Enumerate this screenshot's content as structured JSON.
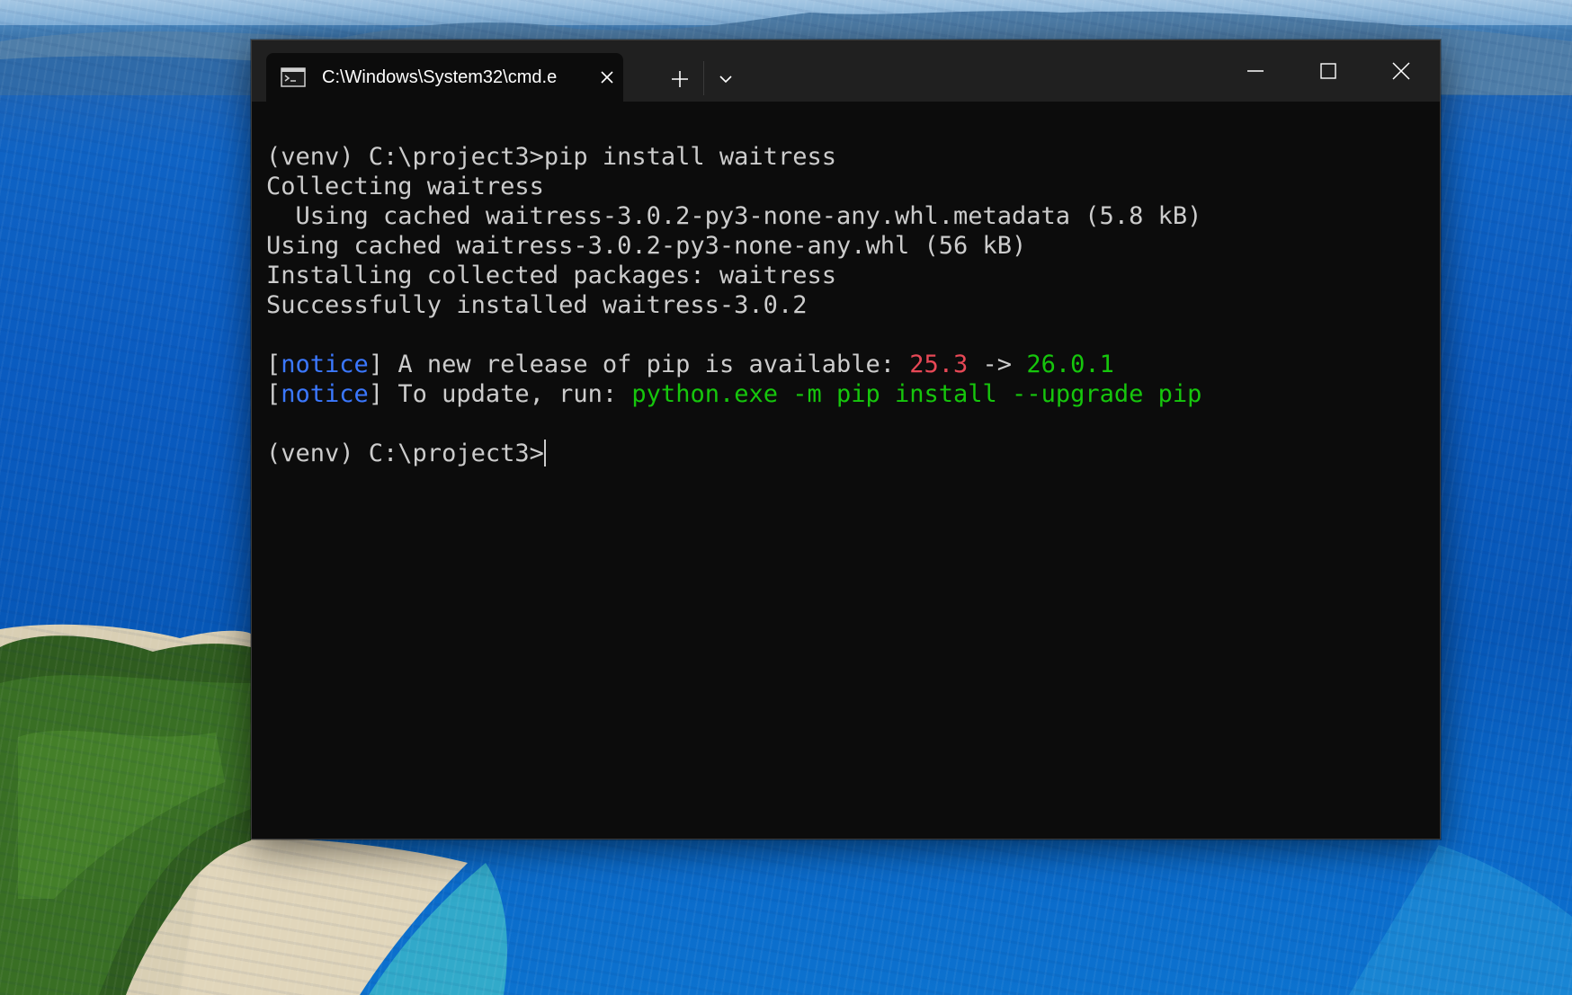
{
  "window": {
    "tab_title": "C:\\Windows\\System32\\cmd.e",
    "tab_icon": "cmd-icon",
    "controls": {
      "minimize_icon": "minimize-icon",
      "maximize_icon": "maximize-icon",
      "close_icon": "close-icon",
      "new_tab_icon": "plus-icon",
      "dropdown_icon": "chevron-down-icon"
    }
  },
  "colors": {
    "terminal_bg": "#0c0c0c",
    "titlebar_bg": "#202020",
    "text": "#cccccc",
    "notice_blue": "#3b78ff",
    "version_red": "#e74856",
    "version_green": "#16c60c"
  },
  "terminal": {
    "lines": [
      [
        {
          "text": "(venv) C:\\project3>pip install waitress",
          "color": "white"
        }
      ],
      [
        {
          "text": "Collecting waitress",
          "color": "white"
        }
      ],
      [
        {
          "text": "  Using cached waitress-3.0.2-py3-none-any.whl.metadata (5.8 kB)",
          "color": "white"
        }
      ],
      [
        {
          "text": "Using cached waitress-3.0.2-py3-none-any.whl (56 kB)",
          "color": "white"
        }
      ],
      [
        {
          "text": "Installing collected packages: waitress",
          "color": "white"
        }
      ],
      [
        {
          "text": "Successfully installed waitress-3.0.2",
          "color": "white"
        }
      ],
      [],
      [
        {
          "text": "[",
          "color": "white"
        },
        {
          "text": "notice",
          "color": "blue"
        },
        {
          "text": "] A new release of pip is available: ",
          "color": "white"
        },
        {
          "text": "25.3",
          "color": "red"
        },
        {
          "text": " -> ",
          "color": "white"
        },
        {
          "text": "26.0.1",
          "color": "green"
        }
      ],
      [
        {
          "text": "[",
          "color": "white"
        },
        {
          "text": "notice",
          "color": "blue"
        },
        {
          "text": "] To update, run: ",
          "color": "white"
        },
        {
          "text": "python.exe -m pip install --upgrade pip",
          "color": "green"
        }
      ],
      [],
      [
        {
          "text": "(venv) C:\\project3>",
          "color": "white"
        }
      ]
    ],
    "cursor_line": 10
  }
}
